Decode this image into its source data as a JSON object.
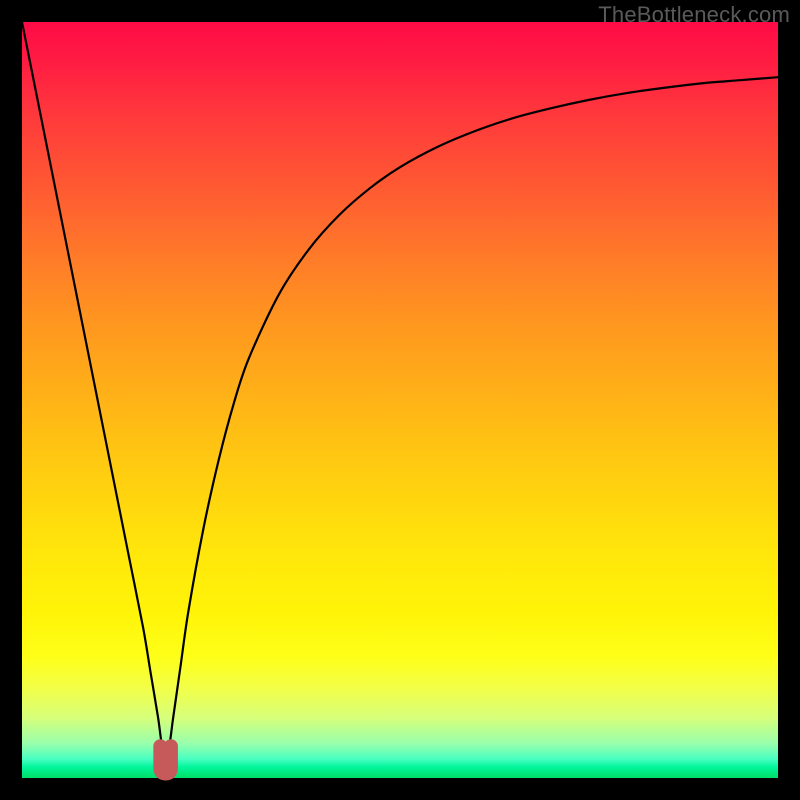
{
  "watermark": "TheBottleneck.com",
  "chart_data": {
    "type": "line",
    "title": "",
    "xlabel": "",
    "ylabel": "",
    "xlim": [
      0,
      100
    ],
    "ylim": [
      0,
      100
    ],
    "grid": false,
    "legend": "none",
    "series": [
      {
        "name": "bottleneck-curve",
        "x": [
          0,
          2,
          4,
          6,
          8,
          10,
          12,
          14,
          16,
          17,
          18,
          18.6,
          19.4,
          20,
          21,
          22,
          24,
          26,
          28,
          30,
          34,
          38,
          42,
          46,
          50,
          55,
          60,
          65,
          70,
          75,
          80,
          85,
          90,
          95,
          100
        ],
        "y": [
          100,
          90,
          80,
          70,
          60,
          50,
          40,
          30,
          20,
          14,
          8,
          4,
          4,
          8,
          15,
          22,
          33,
          42,
          49.5,
          55.5,
          64,
          70,
          74.5,
          78,
          80.8,
          83.5,
          85.6,
          87.3,
          88.6,
          89.7,
          90.6,
          91.3,
          91.9,
          92.3,
          92.7
        ]
      }
    ],
    "annotations": [
      {
        "name": "optimal-marker",
        "shape": "u",
        "x_range": [
          18.3,
          19.7
        ],
        "y_range": [
          0.6,
          4.2
        ],
        "color": "#c65a5a"
      }
    ]
  }
}
